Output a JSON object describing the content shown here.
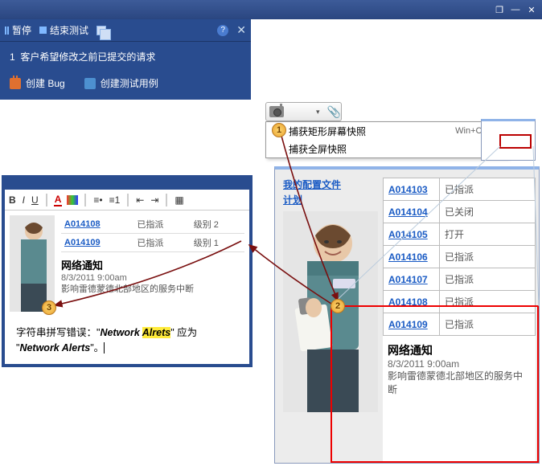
{
  "title_bar": {
    "restore": "❐",
    "min": "—",
    "close": "✕"
  },
  "toolbar": {
    "pause": "暂停",
    "end_test": "结束测试",
    "help": "?",
    "close": "✕"
  },
  "request": {
    "num": "1",
    "text": "客户希望修改之前已提交的请求"
  },
  "actions": {
    "create_bug": "创建 Bug",
    "create_test": "创建测试用例"
  },
  "capture_menu": {
    "rect": "捕获矩形屏幕快照",
    "full": "捕获全屏快照",
    "shortcut": "Win+Ctrl+C",
    "dropdown": "▾",
    "clip": "📎"
  },
  "editor_toolbar": {
    "b": "B",
    "i": "I",
    "u": "U",
    "a": "A"
  },
  "mini_table": [
    {
      "id": "A014108",
      "status": "已指派",
      "level": "级别 2"
    },
    {
      "id": "A014109",
      "status": "已指派",
      "level": "级别 1"
    }
  ],
  "notice": {
    "title": "网络通知",
    "time": "8/3/2011 9:00am",
    "desc": "影响雷德蒙德北部地区的服务中断"
  },
  "spell": {
    "pre": "字符串拼写错误：\"",
    "w1": "Network ",
    "err": "Alrets",
    "mid": "\"  应为 \"",
    "fix": "Network Alerts",
    "post": "\"。"
  },
  "browser": {
    "profile": "我的配置文件",
    "plan": "计划"
  },
  "big_table": [
    {
      "id": "A014103",
      "status": "已指派"
    },
    {
      "id": "A014104",
      "status": "已关闭"
    },
    {
      "id": "A014105",
      "status": "打开"
    },
    {
      "id": "A014106",
      "status": "已指派"
    },
    {
      "id": "A014107",
      "status": "已指派"
    },
    {
      "id": "A014108",
      "status": "已指派"
    },
    {
      "id": "A014109",
      "status": "已指派"
    }
  ],
  "callouts": {
    "n1": "1",
    "n2": "2",
    "n3": "3"
  }
}
